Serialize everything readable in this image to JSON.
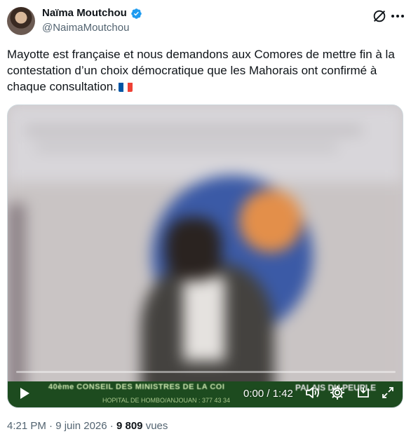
{
  "author": {
    "display_name": "Naïma Moutchou",
    "handle": "@NaimaMoutchou",
    "verified": true,
    "verified_color": "#1d9bf0"
  },
  "header_actions": {
    "grok_icon": "grok-icon",
    "more_icon": "more-icon"
  },
  "tweet": {
    "text": "Mayotte est française et nous demandons aux Comores de mettre fin à la contestation d’un choix démocratique que les Mahorais ont confirmé à chaque consultation.",
    "emoji": "flag-france"
  },
  "video": {
    "ticker_text": "40ème CONSEIL DES MINISTRES DE LA COI",
    "ticker_sub": "HOPITAL DE HOMBO/ANJOUAN : 377 43 34",
    "ticker_right": "PALAIS DU PEUPLE",
    "time_display": "0:00 / 1:42",
    "progress": 0
  },
  "footer": {
    "time": "4:21 PM",
    "separator": "·",
    "date": "9 juin 2026",
    "views_count": "9 809",
    "views_label": "vues"
  },
  "colors": {
    "text": "#0f1419",
    "secondary": "#536471",
    "ticker_bg": "#1d4b1f"
  }
}
